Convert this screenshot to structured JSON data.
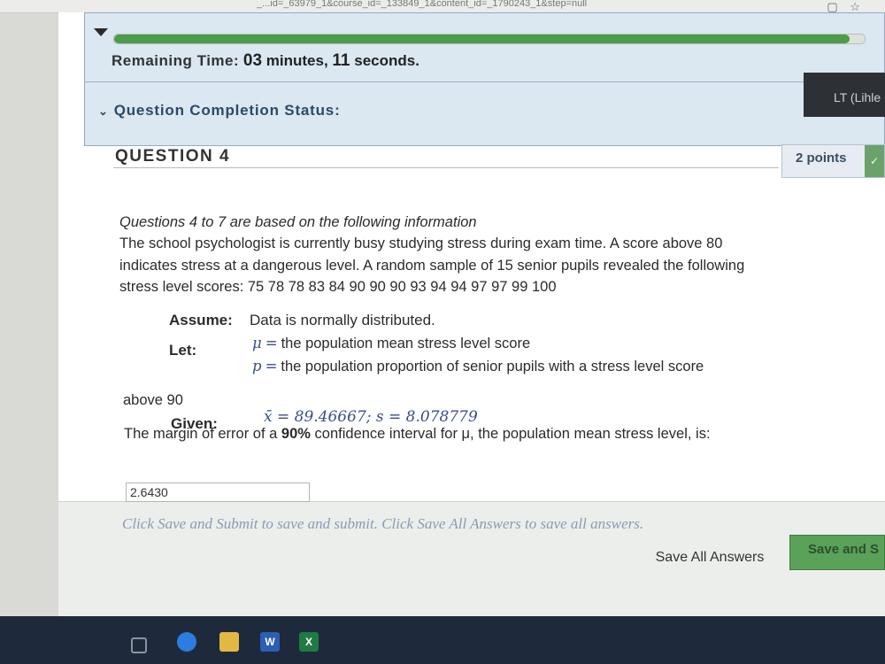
{
  "browser": {
    "url": "_...id=_63979_1&course_id=_133849_1&content_id=_1790243_1&step=null",
    "icons": [
      "square-icon",
      "star-icon"
    ]
  },
  "status": {
    "progress_percent": 98,
    "remaining_label": "Remaining Time:",
    "remaining_minutes": "03",
    "minutes_unit": "minutes,",
    "remaining_seconds": "11",
    "seconds_unit": "seconds.",
    "completion_label": "Question Completion Status:",
    "lt_badge": "LT (Lihle"
  },
  "question": {
    "header": "QUESTION 4",
    "points": "2 points",
    "intro": "Questions 4 to 7 are based on the following information",
    "body": "The school psychologist is currently busy studying stress during exam time. A score above 80 indicates stress at a dangerous level. A random sample of 15 senior pupils revealed the following stress level scores:  75 78  78  83  84  90  90  90  93  94  94  97  97  99  100",
    "assume_label": "Assume:",
    "assume_value": "Data is normally distributed.",
    "let_label": "Let:",
    "mu_symbol": "μ",
    "mu_def": "the population mean stress level score",
    "p_symbol": "p",
    "p_def": "the population proportion of senior pupils with a stress level score",
    "p_def_cont": "above 90",
    "given_label": "Given:",
    "given_value": "x̄ = 89.46667; s = 8.078779",
    "text_before": "The margin of error of a ",
    "text_bold": "90%",
    "text_after": " confidence interval for μ, the population mean stress level, is:",
    "answer_value": "2.6430"
  },
  "footer": {
    "hint": "Click Save and Submit to save and submit. Click Save All Answers to save all answers.",
    "save_all_label": "Save All Answers",
    "save_submit_label": "Save and S"
  },
  "taskbar": {
    "word_glyph": "W",
    "excel_glyph": "X"
  },
  "colors": {
    "progress": "#4d9b4d",
    "panel": "#dbe7f1",
    "submit_button": "#5aa15a",
    "taskbar": "#1e2a3c"
  }
}
